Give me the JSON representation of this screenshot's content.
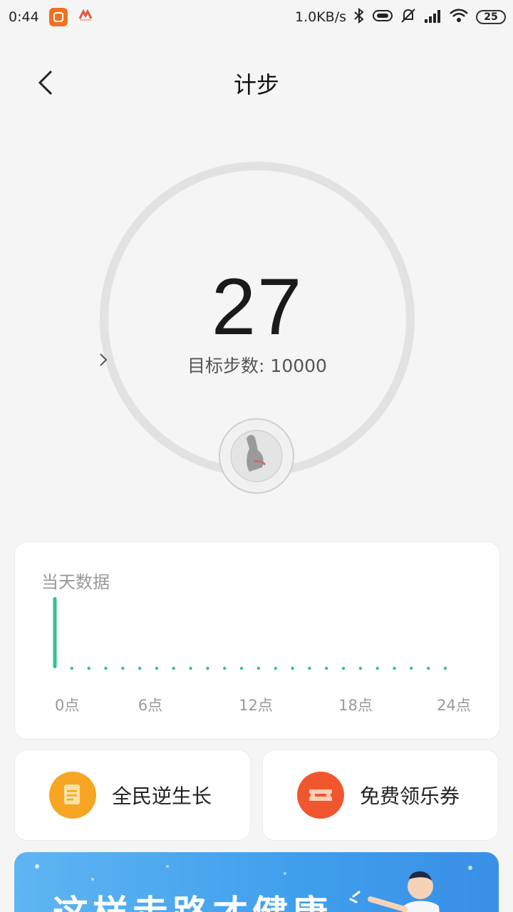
{
  "status_bar": {
    "time": "0:44",
    "net_speed": "1.0KB/s",
    "battery": "25",
    "icons": [
      "mi-app-icon",
      "notification-app-icon",
      "bluetooth-icon",
      "vibrate-icon",
      "mute-icon",
      "signal-icon",
      "wifi-icon",
      "battery-icon"
    ]
  },
  "header": {
    "title": "计步",
    "back_icon": "chevron-left-icon"
  },
  "ring": {
    "steps": "27",
    "goal_label": "目标步数: 10000",
    "progress": 0.0027,
    "track_color": "#e2e2e2"
  },
  "day_card": {
    "title": "当天数据",
    "x_labels": [
      "0点",
      "6点",
      "12点",
      "18点",
      "24点"
    ],
    "accent": "#2ec493"
  },
  "chart_data": {
    "type": "bar",
    "x_range": [
      0,
      24
    ],
    "hourly_steps": [
      27,
      0,
      0,
      0,
      0,
      0,
      0,
      0,
      0,
      0,
      0,
      0,
      0,
      0,
      0,
      0,
      0,
      0,
      0,
      0,
      0,
      0,
      0,
      0
    ],
    "tick_labels": [
      "0点",
      "6点",
      "12点",
      "18点",
      "24点"
    ]
  },
  "buttons": [
    {
      "label": "全民逆生长",
      "icon": "document-icon",
      "color": "#f6a623"
    },
    {
      "label": "免费领乐券",
      "icon": "ticket-icon",
      "color": "#f0572f"
    }
  ],
  "banner": {
    "text": "这样走路才健康"
  }
}
